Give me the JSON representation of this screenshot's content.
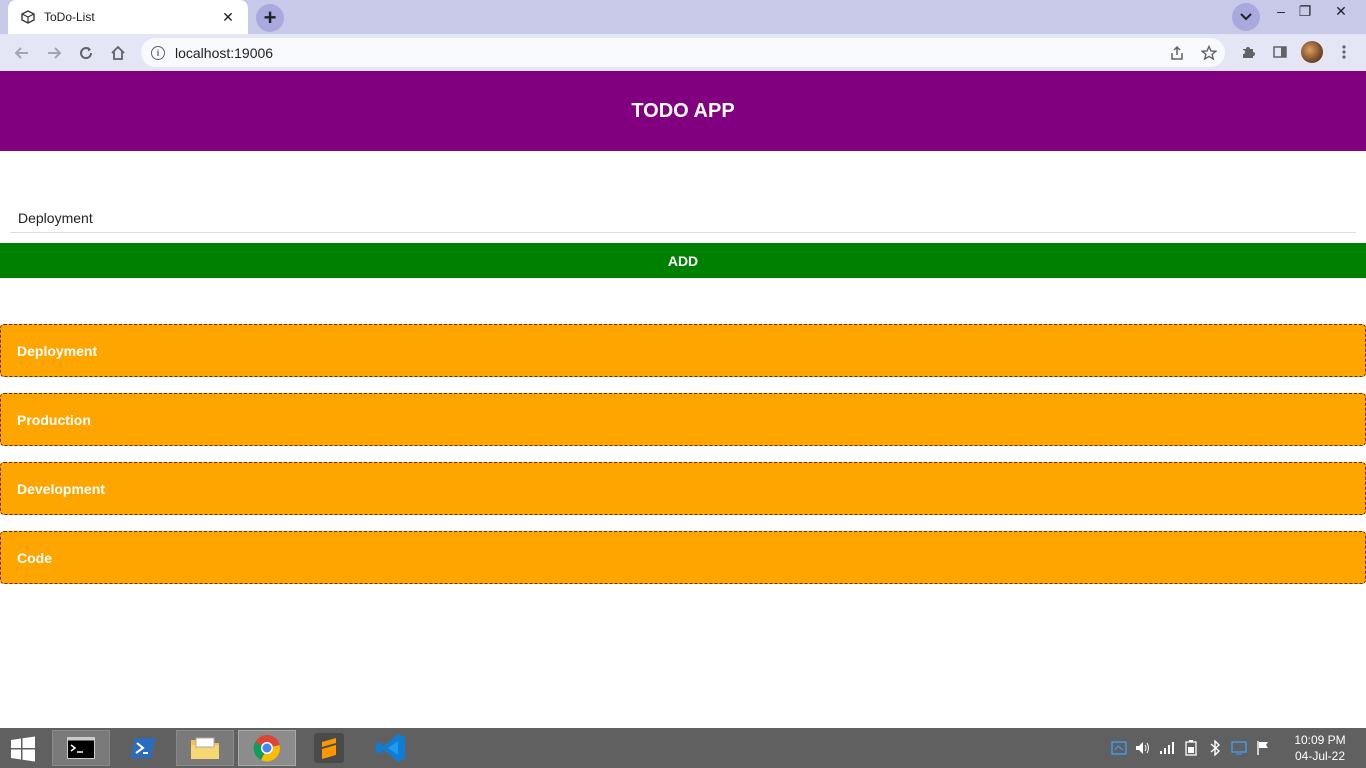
{
  "browser": {
    "tab": {
      "title": "ToDo-List",
      "favicon": "gear-cube-icon",
      "close": "✕"
    },
    "new_tab": "+",
    "url": "localhost:19006",
    "window_controls": {
      "minimize": "–",
      "restore": "❐",
      "close": "✕"
    }
  },
  "app": {
    "header_title": "TODO APP",
    "input": {
      "value": "Deployment",
      "placeholder": ""
    },
    "add_label": "ADD",
    "todos": [
      {
        "label": "Deployment"
      },
      {
        "label": "Production"
      },
      {
        "label": "Development"
      },
      {
        "label": "Code"
      }
    ],
    "colors": {
      "header": "#800080",
      "add_button": "#008000",
      "todo_item": "#ffa500",
      "todo_border": "#6b2b00"
    }
  },
  "taskbar": {
    "apps": [
      "command-prompt-icon",
      "powershell-icon",
      "file-explorer-icon",
      "chrome-icon",
      "sublime-text-icon",
      "vscode-icon"
    ],
    "clock": {
      "time": "10:09 PM",
      "date": "04-Jul-22"
    }
  }
}
